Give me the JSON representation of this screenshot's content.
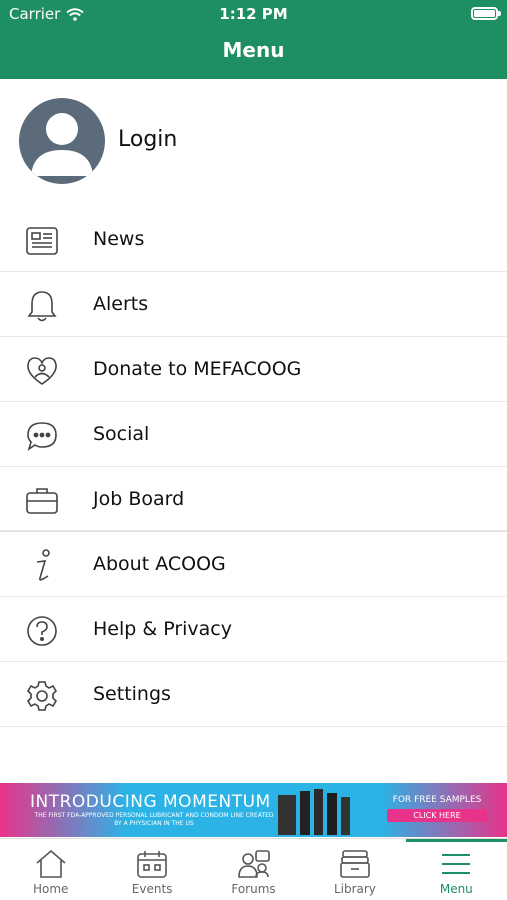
{
  "status_bar": {
    "carrier": "Carrier",
    "time": "1:12 PM"
  },
  "header": {
    "title": "Menu"
  },
  "login": {
    "label": "Login"
  },
  "menu_primary": [
    {
      "label": "News",
      "icon": "newspaper-icon"
    },
    {
      "label": "Alerts",
      "icon": "bell-icon"
    },
    {
      "label": "Donate to MEFACOOG",
      "icon": "heart-hand-icon"
    },
    {
      "label": "Social",
      "icon": "chat-bubble-icon"
    },
    {
      "label": "Job Board",
      "icon": "briefcase-icon"
    }
  ],
  "menu_secondary": [
    {
      "label": "About ACOOG",
      "icon": "info-icon"
    },
    {
      "label": "Help & Privacy",
      "icon": "question-icon"
    },
    {
      "label": "Settings",
      "icon": "gear-icon"
    }
  ],
  "banner": {
    "title": "INTRODUCING MOMENTUM",
    "subtitle": "THE FIRST FDA-APPROVED PERSONAL LUBRICANT AND CONDOM LINE CREATED BY A PHYSICIAN IN THE US",
    "cta": "FOR FREE SAMPLES",
    "button": "CLICK HERE"
  },
  "tabs": [
    {
      "label": "Home",
      "icon": "home-icon"
    },
    {
      "label": "Events",
      "icon": "calendar-icon"
    },
    {
      "label": "Forums",
      "icon": "people-icon"
    },
    {
      "label": "Library",
      "icon": "archive-icon"
    },
    {
      "label": "Menu",
      "icon": "hamburger-icon",
      "active": true
    }
  ],
  "colors": {
    "accent": "#1e8f62",
    "avatar": "#5b6b7a"
  }
}
